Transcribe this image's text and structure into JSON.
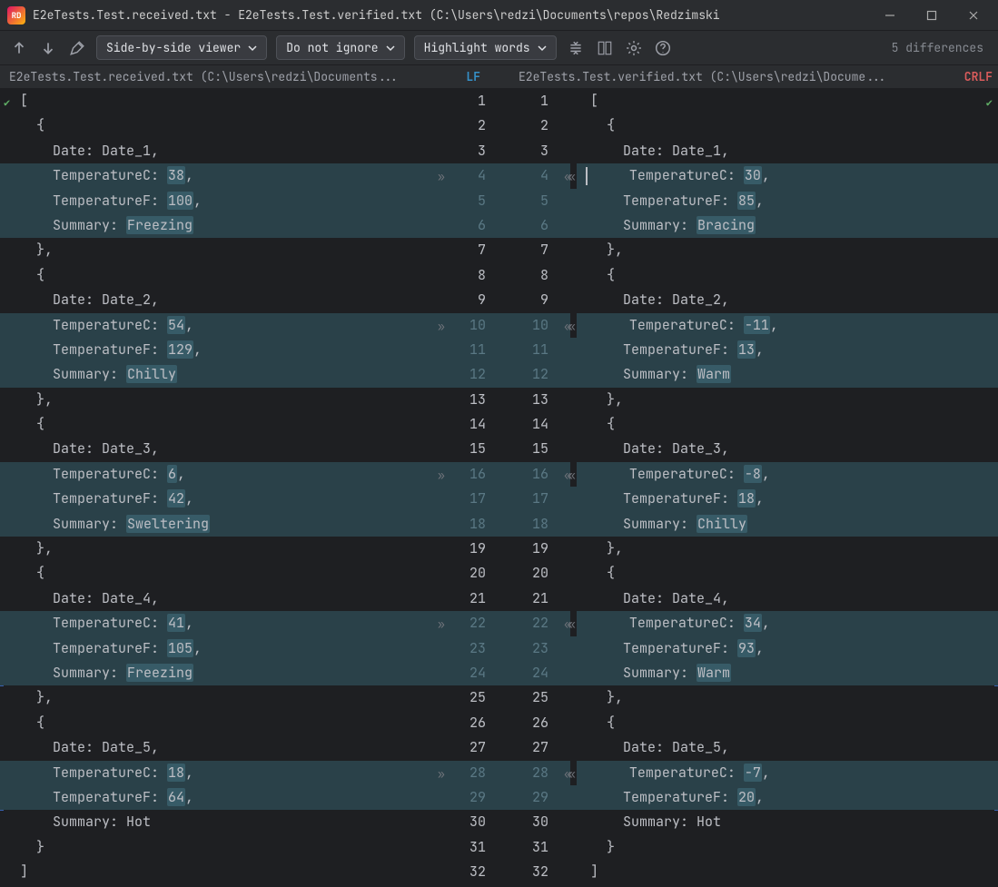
{
  "window": {
    "title": "E2eTests.Test.received.txt - E2eTests.Test.verified.txt (C:\\Users\\redzi\\Documents\\repos\\Redzimski"
  },
  "toolbar": {
    "viewer_mode": "Side-by-side viewer",
    "ignore_mode": "Do not ignore",
    "highlight_mode": "Highlight words",
    "diff_count": "5 differences"
  },
  "files": {
    "left_name": "E2eTests.Test.received.txt (C:\\Users\\redzi\\Documents...",
    "left_eol": "LF",
    "right_name": "E2eTests.Test.verified.txt (C:\\Users\\redzi\\Docume...",
    "right_eol": "CRLF"
  },
  "lines": [
    {
      "n": 1,
      "l": "[",
      "r": "[",
      "diff": false
    },
    {
      "n": 2,
      "l": "  {",
      "r": "  {",
      "diff": false
    },
    {
      "n": 3,
      "l": "    Date: Date_1,",
      "r": "    Date: Date_1,",
      "diff": false
    },
    {
      "n": 4,
      "l": "    TemperatureC: |38|,",
      "r": "    TemperatureC: |30|,",
      "diff": true,
      "first": true
    },
    {
      "n": 5,
      "l": "    TemperatureF: |100|,",
      "r": "    TemperatureF: |85|,",
      "diff": true
    },
    {
      "n": 6,
      "l": "    Summary: |Freezing|",
      "r": "    Summary: |Bracing|",
      "diff": true
    },
    {
      "n": 7,
      "l": "  },",
      "r": "  },",
      "diff": false
    },
    {
      "n": 8,
      "l": "  {",
      "r": "  {",
      "diff": false
    },
    {
      "n": 9,
      "l": "    Date: Date_2,",
      "r": "    Date: Date_2,",
      "diff": false
    },
    {
      "n": 10,
      "l": "    TemperatureC: |54|,",
      "r": "    TemperatureC: |-11|,",
      "diff": true,
      "first": true
    },
    {
      "n": 11,
      "l": "    TemperatureF: |129|,",
      "r": "    TemperatureF: |13|,",
      "diff": true
    },
    {
      "n": 12,
      "l": "    Summary: |Chilly|",
      "r": "    Summary: |Warm|",
      "diff": true
    },
    {
      "n": 13,
      "l": "  },",
      "r": "  },",
      "diff": false
    },
    {
      "n": 14,
      "l": "  {",
      "r": "  {",
      "diff": false
    },
    {
      "n": 15,
      "l": "    Date: Date_3,",
      "r": "    Date: Date_3,",
      "diff": false
    },
    {
      "n": 16,
      "l": "    TemperatureC: |6|,",
      "r": "    TemperatureC: |-8|,",
      "diff": true,
      "first": true
    },
    {
      "n": 17,
      "l": "    TemperatureF: |42|,",
      "r": "    TemperatureF: |18|,",
      "diff": true
    },
    {
      "n": 18,
      "l": "    Summary: |Sweltering|",
      "r": "    Summary: |Chilly|",
      "diff": true
    },
    {
      "n": 19,
      "l": "  },",
      "r": "  },",
      "diff": false
    },
    {
      "n": 20,
      "l": "  {",
      "r": "  {",
      "diff": false
    },
    {
      "n": 21,
      "l": "    Date: Date_4,",
      "r": "    Date: Date_4,",
      "diff": false
    },
    {
      "n": 22,
      "l": "    TemperatureC: |41|,",
      "r": "    TemperatureC: |34|,",
      "diff": true,
      "first": true
    },
    {
      "n": 23,
      "l": "    TemperatureF: |105|,",
      "r": "    TemperatureF: |93|,",
      "diff": true
    },
    {
      "n": 24,
      "l": "    Summary: |Freezing|",
      "r": "    Summary: |Warm|",
      "diff": true
    },
    {
      "n": 25,
      "l": "  },",
      "r": "  },",
      "diff": false
    },
    {
      "n": 26,
      "l": "  {",
      "r": "  {",
      "diff": false
    },
    {
      "n": 27,
      "l": "    Date: Date_5,",
      "r": "    Date: Date_5,",
      "diff": false
    },
    {
      "n": 28,
      "l": "    TemperatureC: |18|,",
      "r": "    TemperatureC: |-7|,",
      "diff": true,
      "first": true
    },
    {
      "n": 29,
      "l": "    TemperatureF: |64|,",
      "r": "    TemperatureF: |20|,",
      "diff": true
    },
    {
      "n": 30,
      "l": "    Summary: Hot",
      "r": "    Summary: Hot",
      "diff": false
    },
    {
      "n": 31,
      "l": "  }",
      "r": "  }",
      "diff": false
    },
    {
      "n": 32,
      "l": "]",
      "r": "]",
      "diff": false
    }
  ]
}
